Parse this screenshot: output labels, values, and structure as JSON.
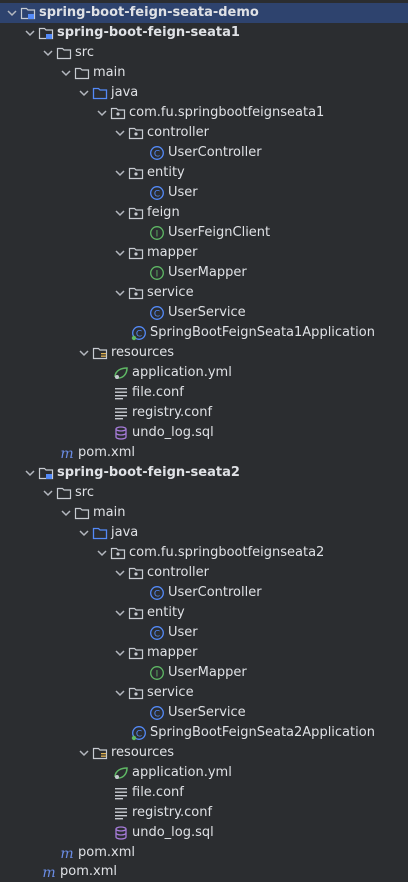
{
  "tree": {
    "root": "spring-boot-feign-seata-demo",
    "m1": {
      "name": "spring-boot-feign-seata1",
      "src": "src",
      "main": "main",
      "java": "java",
      "pkg": "com.fu.springbootfeignseata1",
      "controller": "controller",
      "user_controller": "UserController",
      "entity": "entity",
      "user": "User",
      "feign": "feign",
      "user_feign_client": "UserFeignClient",
      "mapper": "mapper",
      "user_mapper": "UserMapper",
      "service": "service",
      "user_service": "UserService",
      "app": "SpringBootFeignSeata1Application",
      "resources": "resources",
      "application_yml": "application.yml",
      "file_conf": "file.conf",
      "registry_conf": "registry.conf",
      "undo_log": "undo_log.sql",
      "pom": "pom.xml"
    },
    "m2": {
      "name": "spring-boot-feign-seata2",
      "src": "src",
      "main": "main",
      "java": "java",
      "pkg": "com.fu.springbootfeignseata2",
      "controller": "controller",
      "user_controller": "UserController",
      "entity": "entity",
      "user": "User",
      "mapper": "mapper",
      "user_mapper": "UserMapper",
      "service": "service",
      "user_service": "UserService",
      "app": "SpringBootFeignSeata2Application",
      "resources": "resources",
      "application_yml": "application.yml",
      "file_conf": "file.conf",
      "registry_conf": "registry.conf",
      "undo_log": "undo_log.sql",
      "pom": "pom.xml"
    },
    "root_pom": "pom.xml"
  },
  "colors": {
    "background": "#2b2d30",
    "selection": "#2e436e",
    "class_icon": "#548af7",
    "interface_icon": "#5fb865",
    "sql_icon": "#a57bd8",
    "maven_icon": "#6b8de6"
  }
}
